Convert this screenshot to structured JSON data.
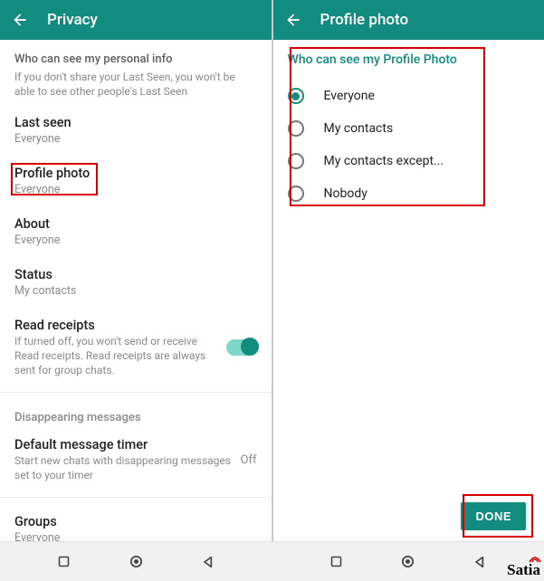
{
  "left": {
    "appbar": {
      "title": "Privacy"
    },
    "info": {
      "header": "Who can see my personal info",
      "sub": "If you don't share your Last Seen, you won't be able to see other people's Last Seen"
    },
    "items": {
      "lastseen": {
        "title": "Last seen",
        "value": "Everyone"
      },
      "profilephoto": {
        "title": "Profile photo",
        "value": "Everyone"
      },
      "about": {
        "title": "About",
        "value": "Everyone"
      },
      "status": {
        "title": "Status",
        "value": "My contacts"
      },
      "readreceipts": {
        "title": "Read receipts",
        "note": "If turned off, you won't send or receive Read receipts. Read receipts are always sent for group chats."
      },
      "disappearing_header": "Disappearing messages",
      "defaulttimer": {
        "title": "Default message timer",
        "note": "Start new chats with disappearing messages set to your timer",
        "value": "Off"
      },
      "groups": {
        "title": "Groups",
        "value": "Everyone"
      }
    }
  },
  "right": {
    "appbar": {
      "title": "Profile photo"
    },
    "radio": {
      "header": "Who can see my Profile Photo",
      "options": [
        {
          "label": "Everyone",
          "selected": true
        },
        {
          "label": "My contacts",
          "selected": false
        },
        {
          "label": "My contacts except...",
          "selected": false
        },
        {
          "label": "Nobody",
          "selected": false
        }
      ]
    },
    "done": "DONE"
  },
  "watermark": "Satia"
}
